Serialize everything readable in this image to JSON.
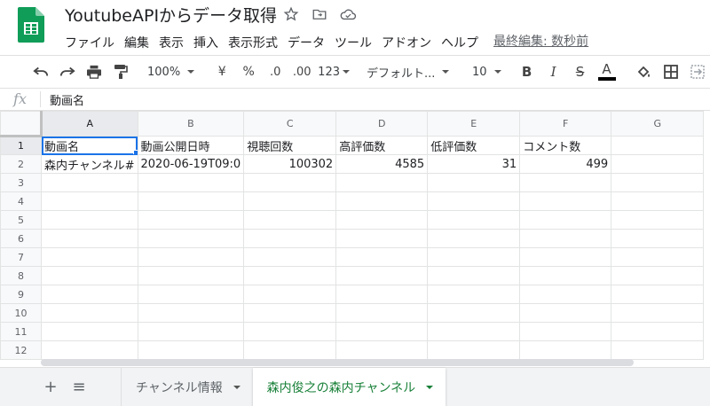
{
  "app": {
    "doc_title": "YoutubeAPIからデータ取得",
    "menu": [
      "ファイル",
      "編集",
      "表示",
      "挿入",
      "表示形式",
      "データ",
      "ツール",
      "アドオン",
      "ヘルプ"
    ],
    "last_edit": "最終編集: 数秒前",
    "brand_color": "#0f9d58"
  },
  "toolbar": {
    "zoom": "100%",
    "currency": "¥",
    "percent": "%",
    "decrease_decimal": ".0",
    "increase_decimal": ".00",
    "number_format": "123",
    "font": "デフォルト...",
    "font_size": "10",
    "bold": "B",
    "italic": "I",
    "strike": "S",
    "text_color": "A"
  },
  "formula_bar": {
    "fx": "fx",
    "value": "動画名"
  },
  "grid": {
    "columns": [
      "A",
      "B",
      "C",
      "D",
      "E",
      "F",
      "G"
    ],
    "rows": [
      [
        "動画名",
        "動画公開日時",
        "視聴回数",
        "高評価数",
        "低評価数",
        "コメント数",
        ""
      ],
      [
        "森内チャンネル#",
        "2020-06-19T09:0",
        "100302",
        "4585",
        "31",
        "499",
        ""
      ],
      [
        "",
        "",
        "",
        "",
        "",
        "",
        ""
      ],
      [
        "",
        "",
        "",
        "",
        "",
        "",
        ""
      ],
      [
        "",
        "",
        "",
        "",
        "",
        "",
        ""
      ],
      [
        "",
        "",
        "",
        "",
        "",
        "",
        ""
      ],
      [
        "",
        "",
        "",
        "",
        "",
        "",
        ""
      ],
      [
        "",
        "",
        "",
        "",
        "",
        "",
        ""
      ],
      [
        "",
        "",
        "",
        "",
        "",
        "",
        ""
      ],
      [
        "",
        "",
        "",
        "",
        "",
        "",
        ""
      ],
      [
        "",
        "",
        "",
        "",
        "",
        "",
        ""
      ],
      [
        "",
        "",
        "",
        "",
        "",
        "",
        ""
      ]
    ],
    "row_numbers": [
      "1",
      "2",
      "3",
      "4",
      "5",
      "6",
      "7",
      "8",
      "9",
      "10",
      "11",
      "12"
    ]
  },
  "sheets": {
    "add": "+",
    "list": "≡",
    "tabs": [
      "チャンネル情報",
      "森内俊之の森内チャンネル"
    ],
    "active_color": "#188038"
  }
}
